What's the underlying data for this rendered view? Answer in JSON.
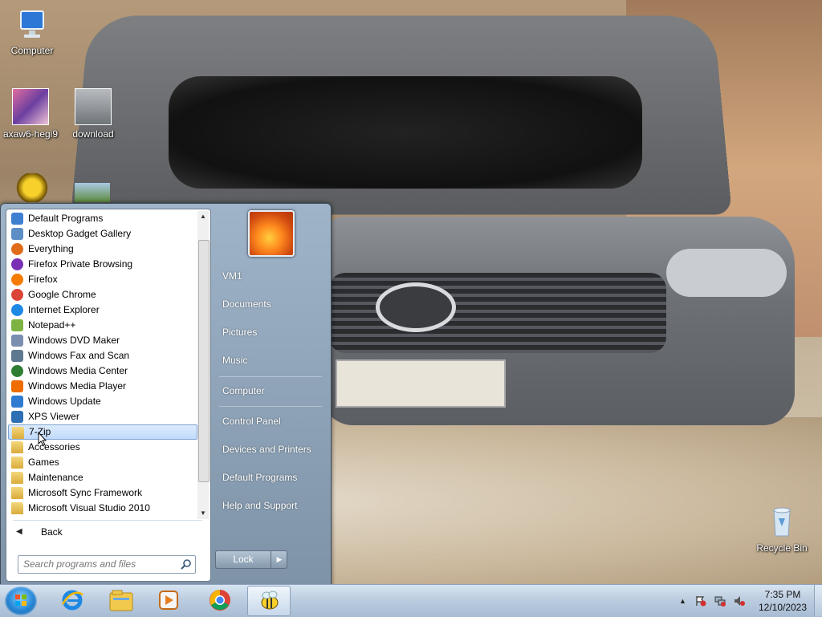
{
  "desktop": {
    "icons": [
      {
        "label": "Computer"
      },
      {
        "label": "axaw6-hegi9"
      },
      {
        "label": "download"
      },
      {
        "label": "Recycle Bin"
      }
    ]
  },
  "start_menu": {
    "programs": [
      {
        "label": "Default Programs",
        "icon": "default-programs-icon"
      },
      {
        "label": "Desktop Gadget Gallery",
        "icon": "gadget-gallery-icon"
      },
      {
        "label": "Everything",
        "icon": "everything-search-icon"
      },
      {
        "label": "Firefox Private Browsing",
        "icon": "firefox-private-icon"
      },
      {
        "label": "Firefox",
        "icon": "firefox-icon"
      },
      {
        "label": "Google Chrome",
        "icon": "chrome-icon"
      },
      {
        "label": "Internet Explorer",
        "icon": "ie-icon"
      },
      {
        "label": "Notepad++",
        "icon": "notepadpp-icon"
      },
      {
        "label": "Windows DVD Maker",
        "icon": "dvd-maker-icon"
      },
      {
        "label": "Windows Fax and Scan",
        "icon": "fax-scan-icon"
      },
      {
        "label": "Windows Media Center",
        "icon": "media-center-icon"
      },
      {
        "label": "Windows Media Player",
        "icon": "media-player-icon"
      },
      {
        "label": "Windows Update",
        "icon": "windows-update-icon"
      },
      {
        "label": "XPS Viewer",
        "icon": "xps-viewer-icon"
      },
      {
        "label": "7-Zip",
        "icon": "folder-icon"
      },
      {
        "label": "Accessories",
        "icon": "folder-icon"
      },
      {
        "label": "Games",
        "icon": "folder-icon"
      },
      {
        "label": "Maintenance",
        "icon": "folder-icon"
      },
      {
        "label": "Microsoft Sync Framework",
        "icon": "folder-icon"
      },
      {
        "label": "Microsoft Visual Studio 2010",
        "icon": "folder-icon"
      }
    ],
    "selected_program": "7-Zip",
    "back_label": "Back",
    "search_placeholder": "Search programs and files",
    "right_links": {
      "user": "VM1",
      "documents": "Documents",
      "pictures": "Pictures",
      "music": "Music",
      "computer": "Computer",
      "control_panel": "Control Panel",
      "devices_printers": "Devices and Printers",
      "default_programs": "Default Programs",
      "help_support": "Help and Support"
    },
    "lock_label": "Lock"
  },
  "taskbar": {
    "pinned": [
      "internet-explorer-icon",
      "windows-explorer-icon",
      "media-player-icon",
      "chrome-icon",
      "bee-app-icon"
    ],
    "active": "bee-app-icon",
    "clock": {
      "time": "7:35 PM",
      "date": "12/10/2023"
    }
  },
  "colors": {
    "accent": "#3b7bd4",
    "taskbar": "#bccde0",
    "selection": "#c1dbfc"
  }
}
